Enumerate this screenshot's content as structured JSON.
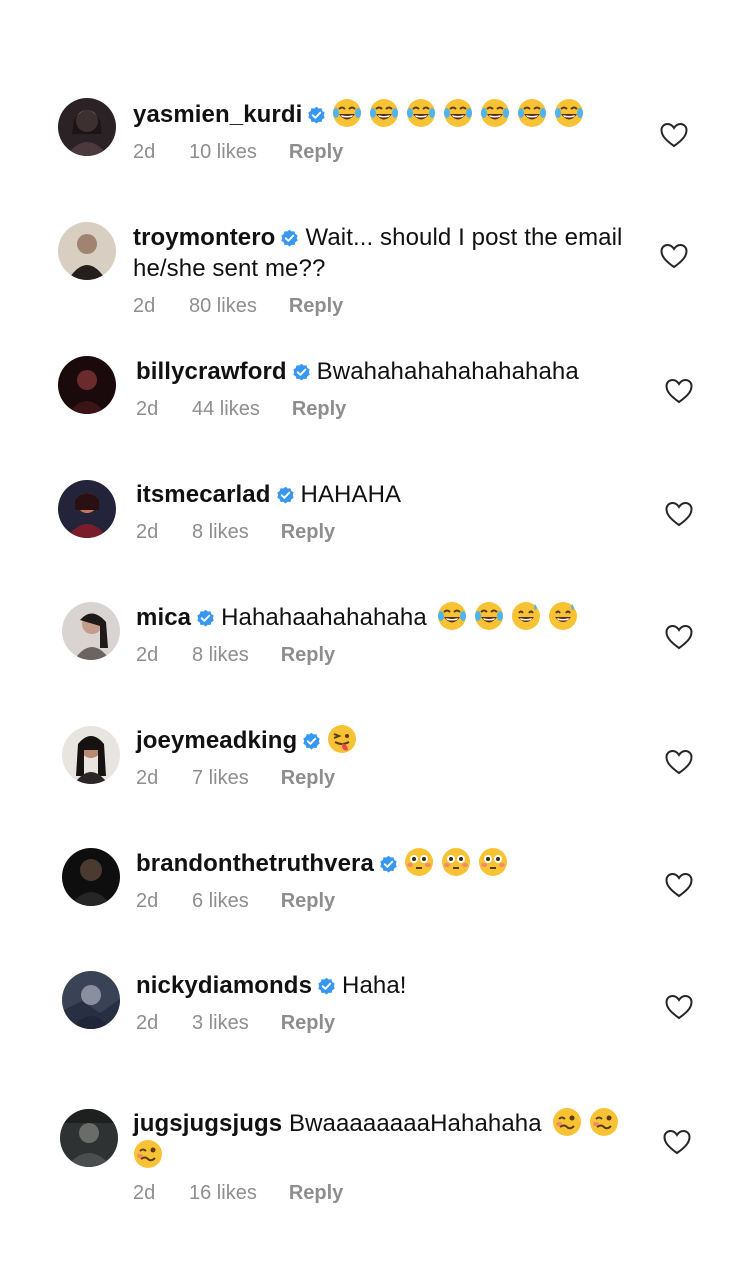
{
  "comments": [
    {
      "username": "yasmien_kurdi",
      "verified": true,
      "text": "",
      "emojis": [
        "tears-of-joy",
        "tears-of-joy",
        "tears-of-joy",
        "tears-of-joy",
        "tears-of-joy",
        "tears-of-joy",
        "tears-of-joy"
      ],
      "time": "2d",
      "likes": "10 likes",
      "reply": "Reply",
      "avatar_color": "#2b2226"
    },
    {
      "username": "troymontero",
      "verified": true,
      "text": "Wait... should I post the email he/she sent me??",
      "emojis": [],
      "time": "2d",
      "likes": "80 likes",
      "reply": "Reply",
      "avatar_color": "#3b3530"
    },
    {
      "username": "billycrawford",
      "verified": true,
      "text": "Bwahahahahahahahaha",
      "emojis": [],
      "time": "2d",
      "likes": "44 likes",
      "reply": "Reply",
      "avatar_color": "#2a0f12"
    },
    {
      "username": "itsmecarlad",
      "verified": true,
      "text": "HAHAHA",
      "emojis": [],
      "time": "2d",
      "likes": "8 likes",
      "reply": "Reply",
      "avatar_color": "#3a1d2a"
    },
    {
      "username": "mica",
      "verified": true,
      "text": "Hahahaahahahaha",
      "emojis": [
        "tears-of-joy",
        "tears-of-joy",
        "grinning-sweat",
        "grinning-sweat"
      ],
      "time": "2d",
      "likes": "8 likes",
      "reply": "Reply",
      "avatar_color": "#b8b2b0"
    },
    {
      "username": "joeymeadking",
      "verified": true,
      "text": "",
      "emojis": [
        "tongue-wink"
      ],
      "time": "2d",
      "likes": "7 likes",
      "reply": "Reply",
      "avatar_color": "#3c3838"
    },
    {
      "username": "brandonthetruthvera",
      "verified": true,
      "text": "",
      "emojis": [
        "flushed",
        "flushed",
        "flushed"
      ],
      "time": "2d",
      "likes": "6 likes",
      "reply": "Reply",
      "avatar_color": "#151515"
    },
    {
      "username": "nickydiamonds",
      "verified": true,
      "text": "Haha!",
      "emojis": [],
      "time": "2d",
      "likes": "3 likes",
      "reply": "Reply",
      "avatar_color": "#2c3240"
    },
    {
      "username": "jugsjugsjugs",
      "verified": false,
      "text": "BwaaaaaaaaHahahaha",
      "emojis": [
        "woozy",
        "woozy",
        "woozy"
      ],
      "time": "2d",
      "likes": "16 likes",
      "reply": "Reply",
      "avatar_color": "#353838"
    }
  ],
  "colors": {
    "verified_badge": "#3897f0",
    "meta_text": "#8e8e8e",
    "emoji_face": "#f7c234"
  },
  "icons": {
    "heart": "heart-outline-icon",
    "verified": "verified-badge-icon"
  }
}
